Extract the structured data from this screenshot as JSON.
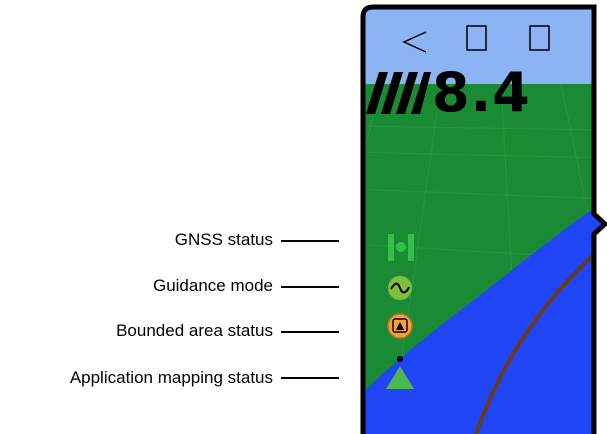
{
  "callouts": {
    "gnss": "GNSS status",
    "guidance": "Guidance mode",
    "bounded": "Bounded area status",
    "mapping": "Application mapping status"
  },
  "display": {
    "speed": "8.4"
  },
  "icons": {
    "nav_back": "back-triangle-icon",
    "nav_home": "home-square-icon",
    "nav_recent": "recent-square-icon",
    "gnss": "gnss-status-icon",
    "guidance": "guidance-curve-icon",
    "bounded": "bounded-area-icon",
    "mapping": "application-mapping-icon",
    "speed_hatch": "hatch-icon"
  },
  "colors": {
    "sky": "#8cb4f4",
    "field": "#1b8a34",
    "coverage": "#1f45f4",
    "path": "#6a3a1c",
    "gnss": "#33c04a",
    "guidance": "#7fbf3a",
    "bounded": "#f2a13a",
    "mapping": "#4fb84f"
  }
}
